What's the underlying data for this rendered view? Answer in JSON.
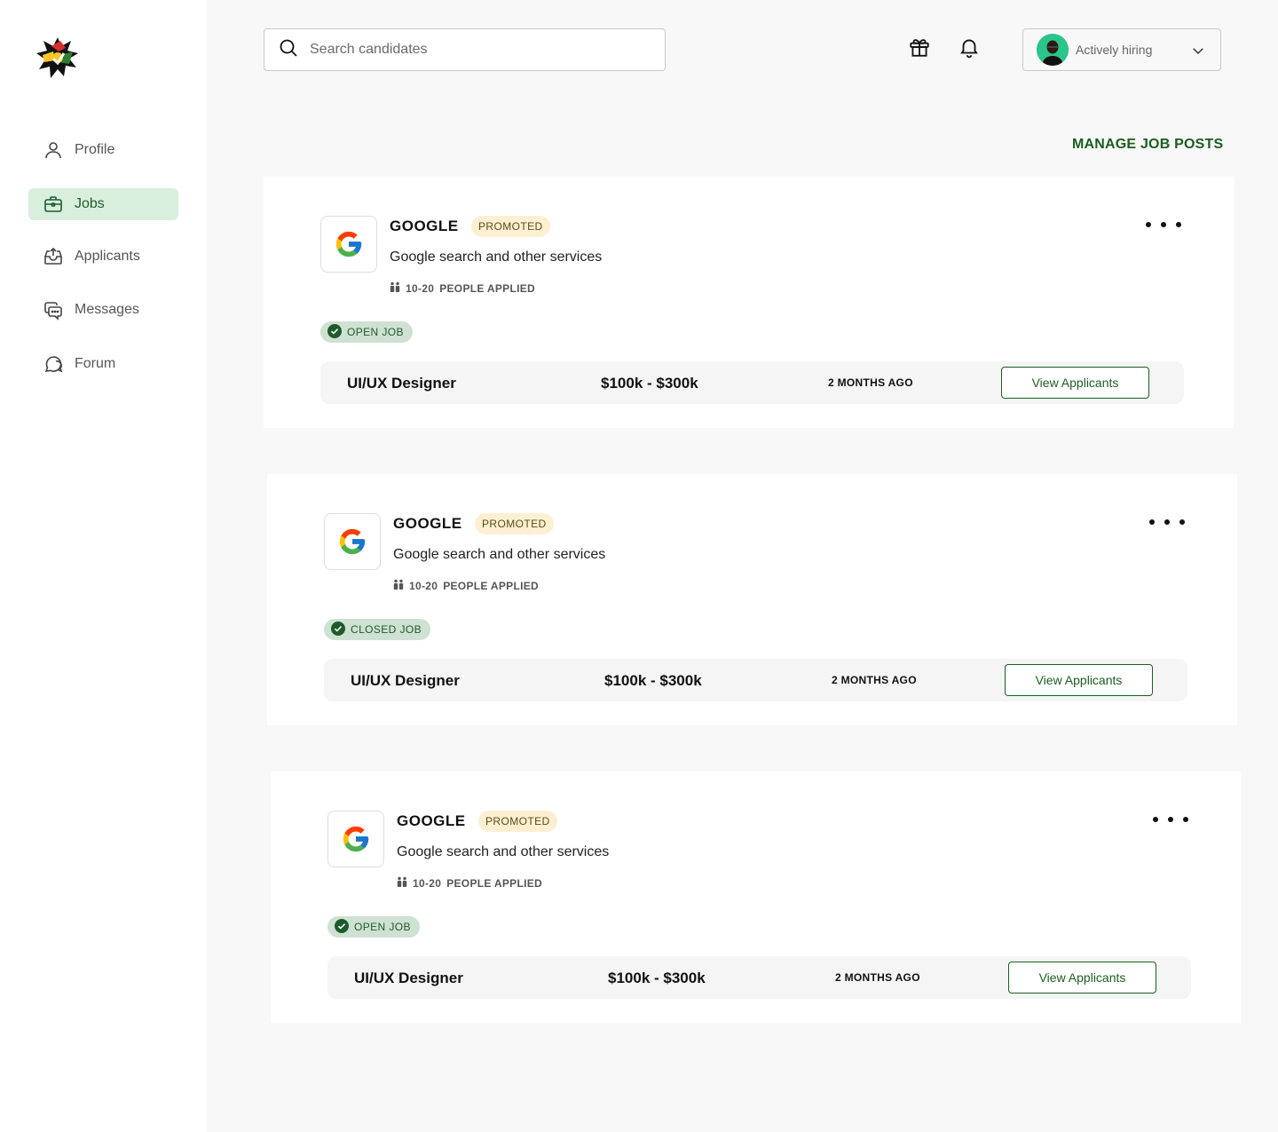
{
  "sidebar": {
    "items": [
      {
        "label": "Profile",
        "icon": "user-icon"
      },
      {
        "label": "Jobs",
        "icon": "briefcase-icon",
        "active": true
      },
      {
        "label": "Applicants",
        "icon": "inbox-icon"
      },
      {
        "label": "Messages",
        "icon": "chat-icon"
      },
      {
        "label": "Forum",
        "icon": "forum-icon"
      }
    ]
  },
  "header": {
    "search_placeholder": "Search candidates",
    "status_label": "Actively hiring"
  },
  "main": {
    "manage_label": "MANAGE JOB POSTS",
    "jobs": [
      {
        "company": "GOOGLE",
        "badge": "PROMOTED",
        "description": "Google search and other services",
        "applied_count": "10-20",
        "applied_label": "PEOPLE APPLIED",
        "status": "OPEN JOB",
        "title": "UI/UX Designer",
        "salary": "$100k - $300k",
        "posted": "2 MONTHS AGO",
        "action": "View Applicants"
      },
      {
        "company": "GOOGLE",
        "badge": "PROMOTED",
        "description": "Google search and other services",
        "applied_count": "10-20",
        "applied_label": "PEOPLE APPLIED",
        "status": "CLOSED JOB",
        "title": "UI/UX Designer",
        "salary": "$100k - $300k",
        "posted": "2 MONTHS AGO",
        "action": "View Applicants"
      },
      {
        "company": "GOOGLE",
        "badge": "PROMOTED",
        "description": "Google search and other services",
        "applied_count": "10-20",
        "applied_label": "PEOPLE APPLIED",
        "status": "OPEN JOB",
        "title": "UI/UX Designer",
        "salary": "$100k - $300k",
        "posted": "2 MONTHS AGO",
        "action": "View Applicants"
      }
    ]
  },
  "colors": {
    "accent": "#1b5e20",
    "active_nav_bg": "#d9efde",
    "promo_bg": "#fdf0d2",
    "status_bg": "#cfe1d2"
  }
}
